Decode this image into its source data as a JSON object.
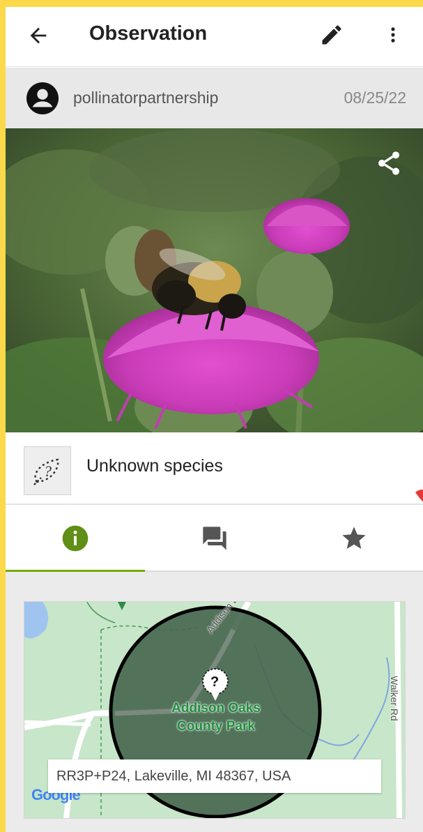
{
  "appbar": {
    "title": "Observation",
    "back_icon": "arrow-left-icon",
    "edit_icon": "pencil-icon",
    "more_icon": "more-vertical-icon"
  },
  "observer": {
    "username": "pollinatorpartnership",
    "date": "08/25/22",
    "avatar_icon": "account-circle-icon"
  },
  "photo": {
    "subject": "bumblebee on purple thistle flower",
    "share_icon": "share-icon"
  },
  "species": {
    "name": "Unknown species",
    "icon": "unknown-species-icon"
  },
  "tabs": [
    {
      "icon": "info-icon",
      "active": true
    },
    {
      "icon": "comments-icon",
      "active": false
    },
    {
      "icon": "star-icon",
      "active": false
    }
  ],
  "map": {
    "park_name": "Addison Oaks County Park",
    "park_line1": "Addison Oaks",
    "park_line2": "County Park",
    "road1": "Addison Blvd",
    "road2": "Walker Rd",
    "address": "RR3P+P24, Lakeville, MI 48367, USA",
    "logo": "Google"
  },
  "colors": {
    "frame": "#fbd94a",
    "accent": "#74ac00",
    "park_text": "#1e8e3e",
    "map_bg": "#c8e6c9"
  }
}
